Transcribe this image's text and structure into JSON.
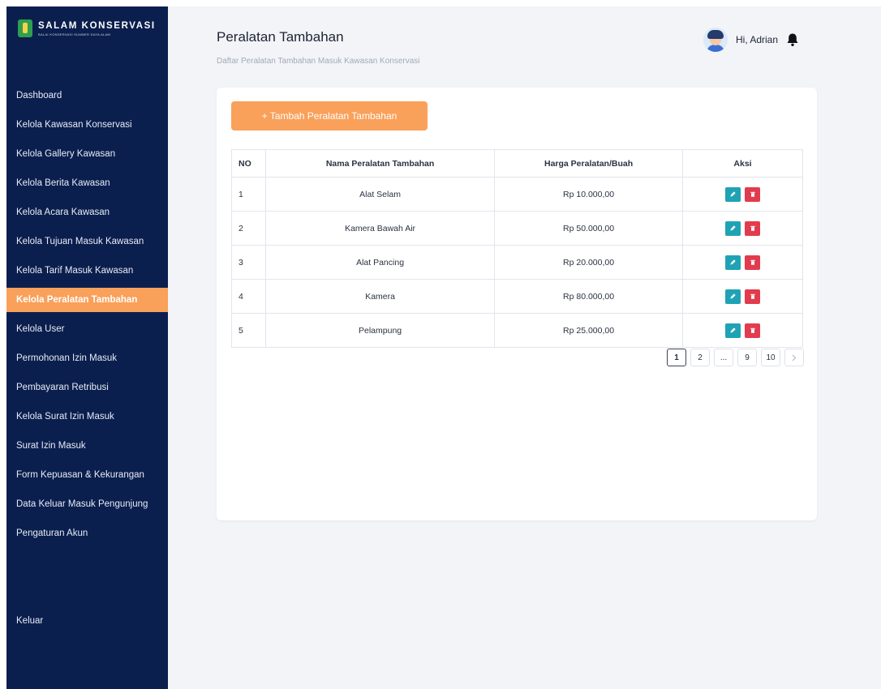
{
  "brand": {
    "title": "SALAM KONSERVASI",
    "subtitle": "BALAI KONSERVASI SUMBER DAYA ALAM"
  },
  "sidebar": {
    "items": [
      {
        "label": "Dashboard",
        "active": false
      },
      {
        "label": "Kelola Kawasan Konservasi",
        "active": false
      },
      {
        "label": "Kelola Gallery Kawasan",
        "active": false
      },
      {
        "label": "Kelola Berita Kawasan",
        "active": false
      },
      {
        "label": "Kelola Acara Kawasan",
        "active": false
      },
      {
        "label": "Kelola Tujuan Masuk Kawasan",
        "active": false
      },
      {
        "label": "Kelola Tarif Masuk Kawasan",
        "active": false
      },
      {
        "label": "Kelola Peralatan Tambahan",
        "active": true
      },
      {
        "label": "Kelola User",
        "active": false
      },
      {
        "label": "Permohonan Izin Masuk",
        "active": false
      },
      {
        "label": "Pembayaran Retribusi",
        "active": false
      },
      {
        "label": "Kelola Surat Izin Masuk",
        "active": false
      },
      {
        "label": "Surat Izin Masuk",
        "active": false
      },
      {
        "label": "Form Kepuasan & Kekurangan",
        "active": false
      },
      {
        "label": "Data Keluar Masuk Pengunjung",
        "active": false
      },
      {
        "label": "Pengaturan Akun",
        "active": false
      }
    ],
    "logout_label": "Keluar"
  },
  "header": {
    "title": "Peralatan Tambahan",
    "subtitle": "Daftar Peralatan Tambahan Masuk Kawasan Konservasi",
    "greeting": "Hi, Adrian"
  },
  "main": {
    "add_button_label": "+ Tambah Peralatan Tambahan",
    "table": {
      "columns": [
        "NO",
        "Nama Peralatan Tambahan",
        "Harga Peralatan/Buah",
        "Aksi"
      ],
      "rows": [
        {
          "no": "1",
          "name": "Alat Selam",
          "price": "Rp 10.000,00"
        },
        {
          "no": "2",
          "name": "Kamera Bawah Air",
          "price": "Rp 50.000,00"
        },
        {
          "no": "3",
          "name": "Alat Pancing",
          "price": "Rp 20.000,00"
        },
        {
          "no": "4",
          "name": "Kamera",
          "price": "Rp 80.000,00"
        },
        {
          "no": "5",
          "name": "Pelampung",
          "price": "Rp 25.000,00"
        }
      ]
    },
    "pagination": {
      "pages": [
        "1",
        "2",
        "...",
        "9",
        "10"
      ],
      "current": "1",
      "next_icon": "chevron-right-icon"
    }
  },
  "colors": {
    "sidebar_bg": "#0b1f4e",
    "accent": "#f9a05a",
    "edit": "#1fa3b4",
    "delete": "#e23b4e"
  }
}
